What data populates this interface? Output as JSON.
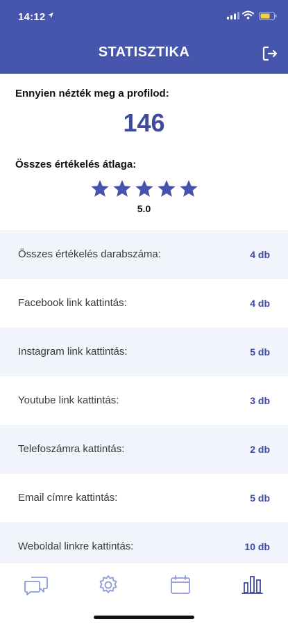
{
  "status_bar": {
    "time": "14:12",
    "icons": [
      "location-arrow-icon",
      "signal-icon",
      "wifi-icon",
      "battery-icon"
    ]
  },
  "header": {
    "title": "STATISZTIKA",
    "logout_icon": "logout-icon"
  },
  "summary": {
    "views_label": "Ennyien nézték meg a profilod:",
    "views_count": "146",
    "avg_label": "Összes értékelés átlaga:",
    "rating_stars": 5,
    "rating_max": 5,
    "rating_value": "5.0"
  },
  "stats": [
    {
      "label": "Összes értékelés darabszáma:",
      "value": "4 db"
    },
    {
      "label": "Facebook link kattintás:",
      "value": "4 db"
    },
    {
      "label": "Instagram link kattintás:",
      "value": "5 db"
    },
    {
      "label": "Youtube link kattintás:",
      "value": "3 db"
    },
    {
      "label": "Telefoszámra kattintás:",
      "value": "2 db"
    },
    {
      "label": "Email címre kattintás:",
      "value": "5 db"
    },
    {
      "label": "Weboldal linkre kattintás:",
      "value": "10 db"
    }
  ],
  "tabbar": {
    "items": [
      "chat-icon",
      "settings-icon",
      "calendar-icon",
      "statistics-icon"
    ],
    "active": "statistics-icon"
  },
  "colors": {
    "header_bg": "#4656ad",
    "accent": "#3d4a9e",
    "row_alt_bg": "#f1f4fb",
    "star": "#4656ad",
    "tab_inactive": "#8e9ad6"
  }
}
